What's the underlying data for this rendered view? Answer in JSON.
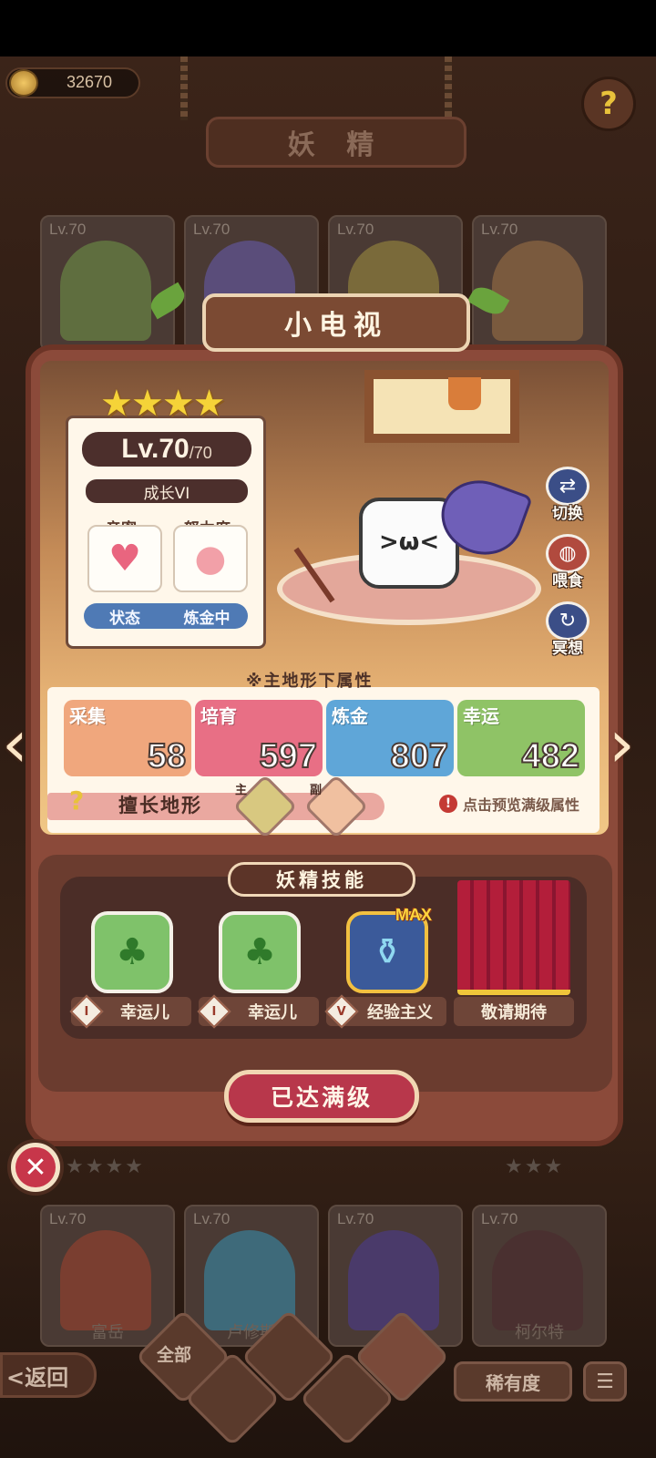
{
  "currency": {
    "amount": "32670",
    "icon": "coin-icon"
  },
  "header": {
    "title": "妖 精"
  },
  "help": {
    "icon": "question-icon",
    "symbol": "?"
  },
  "background_cards_top": [
    {
      "level": "Lv.70"
    },
    {
      "level": "Lv.70"
    },
    {
      "level": "Lv.70"
    },
    {
      "level": "Lv.70"
    }
  ],
  "background_cards_bottom": [
    {
      "level": "Lv.70",
      "name": "富岳"
    },
    {
      "level": "Lv.70",
      "name": "卢修斯"
    },
    {
      "level": "Lv.70",
      "name": ""
    },
    {
      "level": "Lv.70",
      "name": "柯尔特"
    }
  ],
  "popup": {
    "name": "小电视",
    "stars": "★★★★",
    "level": "Lv.70",
    "level_max": "/70",
    "growth": "成长VI",
    "intimacy_label": "亲密",
    "effort_label": "努力度",
    "status_label": "状态",
    "status_value": "炼金中",
    "side_buttons": {
      "switch": "切换",
      "feed": "喂食",
      "meditate": "冥想"
    },
    "attr_title": "※主地形下属性",
    "attributes": [
      {
        "name": "采集",
        "value": "58",
        "color": "#f0a77d"
      },
      {
        "name": "培育",
        "value": "597",
        "color": "#e86f85"
      },
      {
        "name": "炼金",
        "value": "807",
        "color": "#5fa6d8"
      },
      {
        "name": "幸运",
        "value": "482",
        "color": "#8fc366"
      }
    ],
    "terrain_label": "擅长地形",
    "terrain_main": "主",
    "terrain_sub": "副",
    "terrain_hint": "点击预览满级属性",
    "skill_title": "妖精技能",
    "skills": [
      {
        "badge": "I",
        "name": "幸运儿",
        "icon": "clover-icon"
      },
      {
        "badge": "I",
        "name": "幸运儿",
        "icon": "clover-icon"
      },
      {
        "badge": "V",
        "name": "经验主义",
        "icon": "pot-icon",
        "tag": "MAX"
      },
      {
        "badge": "",
        "name": "敬请期待",
        "icon": "curtain-icon"
      }
    ],
    "maxed_button": "已达满级"
  },
  "nav": {
    "back": "<返回",
    "filter_all": "全部",
    "rarity": "稀有度",
    "sort_icon": "sort-icon"
  },
  "colors": {
    "panel": "#8b4a3a",
    "accent_red": "#b8374b",
    "stars": "#f5d338"
  }
}
